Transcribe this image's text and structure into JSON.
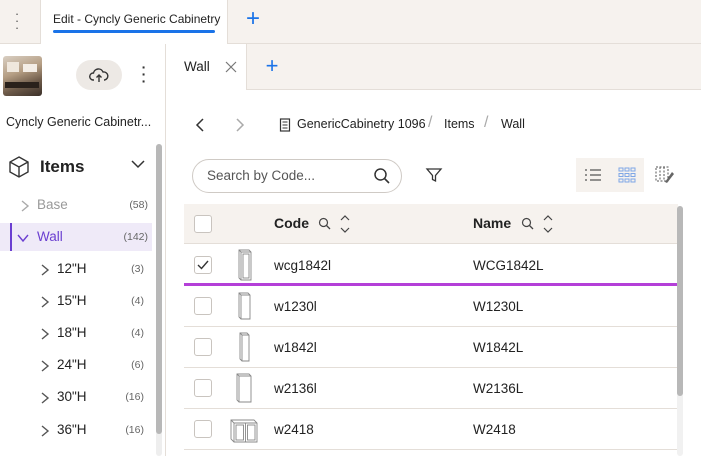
{
  "top_tabs": {
    "active_tab_label": "Edit - Cyncly Generic Cabinetry",
    "more_icon": "kebab-vertical-icon",
    "add_tab_icon": "plus-icon"
  },
  "sidebar": {
    "catalog_name": "Cyncly Generic Cabinetr...",
    "upload_icon": "cloud-upload-icon",
    "items_header": "Items",
    "tree": [
      {
        "label": "Base",
        "count": "(58)",
        "level": 0,
        "state": "collapsed",
        "muted": true
      },
      {
        "label": "Wall",
        "count": "(142)",
        "level": 0,
        "state": "expanded",
        "selected": true
      },
      {
        "label": "12\"H",
        "count": "(3)",
        "level": 1,
        "state": "collapsed"
      },
      {
        "label": "15\"H",
        "count": "(4)",
        "level": 1,
        "state": "collapsed"
      },
      {
        "label": "18\"H",
        "count": "(4)",
        "level": 1,
        "state": "collapsed"
      },
      {
        "label": "24\"H",
        "count": "(6)",
        "level": 1,
        "state": "collapsed"
      },
      {
        "label": "30\"H",
        "count": "(16)",
        "level": 1,
        "state": "collapsed"
      },
      {
        "label": "36\"H",
        "count": "(16)",
        "level": 1,
        "state": "collapsed"
      }
    ]
  },
  "main": {
    "tab_label": "Wall",
    "breadcrumb": {
      "catalog": "GenericCabinetry 1096",
      "section": "Items",
      "current": "Wall"
    },
    "search": {
      "placeholder": "Search by Code...",
      "value": ""
    },
    "table": {
      "columns": [
        "Code",
        "Name"
      ],
      "rows": [
        {
          "code": "wcg1842l",
          "name": "WCG1842L",
          "checked": true,
          "icon": "tall-wall-cabinet-icon"
        },
        {
          "code": "w1230l",
          "name": "W1230L",
          "checked": false,
          "icon": "wall-cabinet-icon"
        },
        {
          "code": "w1842l",
          "name": "W1842L",
          "checked": false,
          "icon": "wall-cabinet-icon"
        },
        {
          "code": "w2136l",
          "name": "W2136L",
          "checked": false,
          "icon": "wall-cabinet-icon"
        },
        {
          "code": "w2418",
          "name": "W2418",
          "checked": false,
          "icon": "double-wall-cabinet-icon"
        }
      ]
    },
    "colors": {
      "accent": "#1a73e8",
      "selection": "#6b3fd1",
      "drop_indicator": "#b43fd8",
      "header_bg": "#f6f2ee"
    }
  }
}
